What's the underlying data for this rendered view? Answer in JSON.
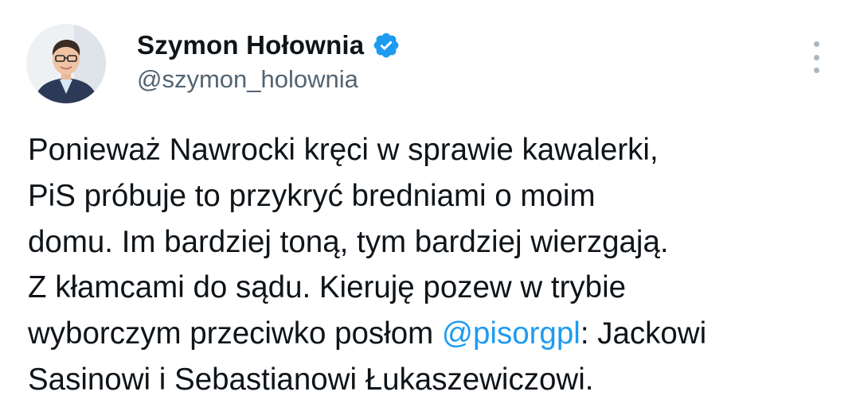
{
  "author": {
    "display_name": "Szymon Hołownia",
    "handle": "@szymon_holownia",
    "verified_icon": "verified-badge-icon",
    "accent": "#1d9bf0"
  },
  "tweet": {
    "lines": [
      {
        "text": "Ponieważ Nawrocki kręci w sprawie kawalerki,"
      },
      {
        "text": "PiS próbuje to przykryć bredniami o moim"
      },
      {
        "text": "domu. Im bardziej toną, tym bardziej wierzgają."
      },
      {
        "text": "Z kłamcami do sądu. Kieruję pozew w trybie"
      },
      {
        "before": "wyborczym przeciwko posłom ",
        "mention": "@pisorgpl",
        "after": ": Jackowi"
      },
      {
        "text": "Sasinowi i Sebastianowi Łukaszewiczowi."
      }
    ]
  },
  "colors": {
    "text": "#0f1419",
    "secondary": "#536471",
    "link": "#1d9bf0"
  }
}
